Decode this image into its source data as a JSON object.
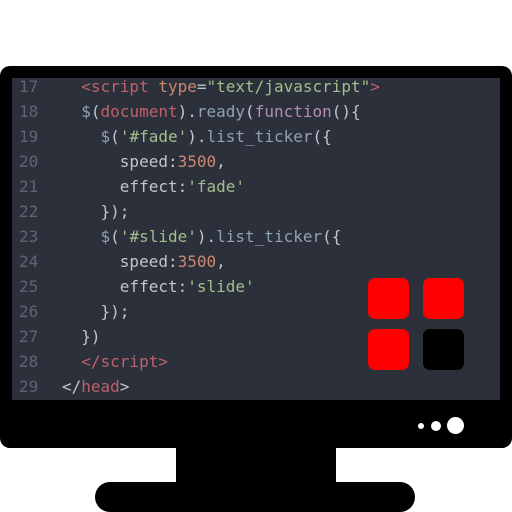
{
  "editor": {
    "lines": [
      {
        "num": "17",
        "tokens": [
          {
            "t": "  ",
            "c": "punct"
          },
          {
            "t": "<script",
            "c": "tag"
          },
          {
            "t": " ",
            "c": "punct"
          },
          {
            "t": "type",
            "c": "attr"
          },
          {
            "t": "=",
            "c": "punct"
          },
          {
            "t": "\"text/javascript\"",
            "c": "str"
          },
          {
            "t": ">",
            "c": "tag"
          }
        ]
      },
      {
        "num": "18",
        "tokens": [
          {
            "t": "  ",
            "c": "punct"
          },
          {
            "t": "$",
            "c": "fn"
          },
          {
            "t": "(",
            "c": "punct"
          },
          {
            "t": "document",
            "c": "var"
          },
          {
            "t": ").",
            "c": "punct"
          },
          {
            "t": "ready",
            "c": "fn"
          },
          {
            "t": "(",
            "c": "punct"
          },
          {
            "t": "function",
            "c": "kw"
          },
          {
            "t": "(){",
            "c": "punct"
          }
        ]
      },
      {
        "num": "19",
        "tokens": [
          {
            "t": "    ",
            "c": "punct"
          },
          {
            "t": "$",
            "c": "fn"
          },
          {
            "t": "(",
            "c": "punct"
          },
          {
            "t": "'#fade'",
            "c": "str"
          },
          {
            "t": ").",
            "c": "punct"
          },
          {
            "t": "list_ticker",
            "c": "fn"
          },
          {
            "t": "({",
            "c": "punct"
          }
        ]
      },
      {
        "num": "20",
        "tokens": [
          {
            "t": "      speed:",
            "c": "punct"
          },
          {
            "t": "3500",
            "c": "num"
          },
          {
            "t": ",",
            "c": "punct"
          }
        ]
      },
      {
        "num": "21",
        "tokens": [
          {
            "t": "      effect:",
            "c": "punct"
          },
          {
            "t": "'fade'",
            "c": "str"
          }
        ]
      },
      {
        "num": "22",
        "tokens": [
          {
            "t": "    });",
            "c": "punct"
          }
        ]
      },
      {
        "num": "23",
        "tokens": [
          {
            "t": "    ",
            "c": "punct"
          },
          {
            "t": "$",
            "c": "fn"
          },
          {
            "t": "(",
            "c": "punct"
          },
          {
            "t": "'#slide'",
            "c": "str"
          },
          {
            "t": ").",
            "c": "punct"
          },
          {
            "t": "list_ticker",
            "c": "fn"
          },
          {
            "t": "({",
            "c": "punct"
          }
        ]
      },
      {
        "num": "24",
        "tokens": [
          {
            "t": "      speed:",
            "c": "punct"
          },
          {
            "t": "3500",
            "c": "num"
          },
          {
            "t": ",",
            "c": "punct"
          }
        ]
      },
      {
        "num": "25",
        "tokens": [
          {
            "t": "      effect:",
            "c": "punct"
          },
          {
            "t": "'slide'",
            "c": "str"
          }
        ]
      },
      {
        "num": "26",
        "tokens": [
          {
            "t": "    });",
            "c": "punct"
          }
        ]
      },
      {
        "num": "27",
        "tokens": [
          {
            "t": "  })",
            "c": "punct"
          }
        ]
      },
      {
        "num": "28",
        "tokens": [
          {
            "t": "  ",
            "c": "punct"
          },
          {
            "t": "</script",
            "c": "tag"
          },
          {
            "t": ">",
            "c": "tag"
          }
        ]
      },
      {
        "num": "29",
        "tokens": [
          {
            "t": "</",
            "c": "punct"
          },
          {
            "t": "head",
            "c": "tag"
          },
          {
            "t": ">",
            "c": "punct"
          }
        ]
      }
    ]
  },
  "colors": {
    "bezel": "#000000",
    "screen": "#2b303b",
    "tile_red": "#ff0000",
    "tile_dark": "#000000"
  },
  "icons": {
    "tiles": "app-grid-icon",
    "indicators": "power-status-icon"
  }
}
